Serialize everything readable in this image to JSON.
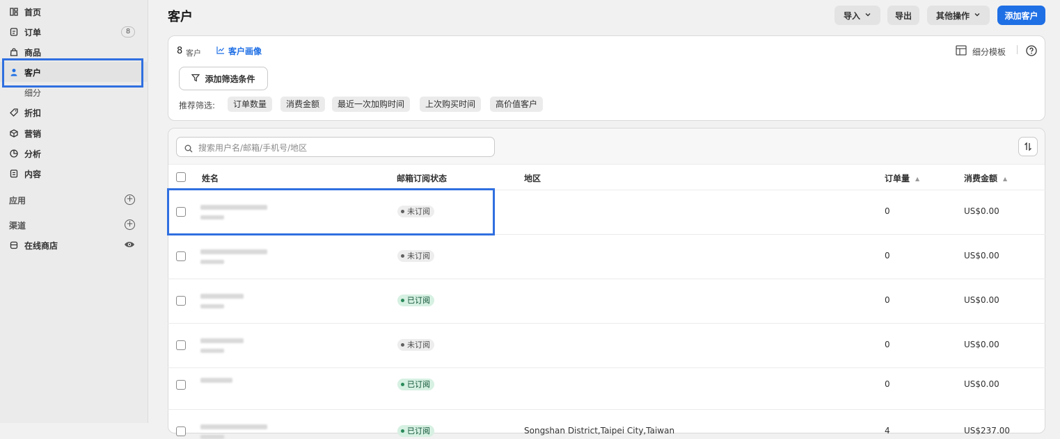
{
  "sidebar": {
    "items": [
      {
        "label": "首页",
        "icon": "home-icon"
      },
      {
        "label": "订单",
        "icon": "orders-icon",
        "badge": "8"
      },
      {
        "label": "商品",
        "icon": "tag-bag-icon"
      },
      {
        "label": "客户",
        "icon": "person-icon"
      },
      {
        "label": "细分"
      },
      {
        "label": "折扣",
        "icon": "discount-icon"
      },
      {
        "label": "营销",
        "icon": "target-icon"
      },
      {
        "label": "分析",
        "icon": "chart-pie-icon"
      },
      {
        "label": "内容",
        "icon": "document-icon"
      }
    ],
    "apps_label": "应用",
    "channels_label": "渠道",
    "store_label": "在线商店"
  },
  "header": {
    "title": "客户",
    "import_label": "导入",
    "export_label": "导出",
    "more_label": "其他操作",
    "add_label": "添加客户"
  },
  "filters": {
    "count": "8",
    "count_unit": "客户",
    "insights_label": "客户画像",
    "segment_template_label": "细分模板",
    "add_filter_label": "添加筛选条件",
    "recommended_label": "推荐筛选:",
    "chips": [
      "订单数量",
      "消费金额",
      "最近一次加购时间",
      "上次购买时间",
      "高价值客户"
    ]
  },
  "table": {
    "search_placeholder": "搜索用户名/邮箱/手机号/地区",
    "columns": {
      "name": "姓名",
      "email_status": "邮箱订阅状态",
      "region": "地区",
      "orders": "订单量",
      "spent": "消费金额"
    },
    "rows": [
      {
        "status": "未订阅",
        "subscribed": false,
        "region": "",
        "orders": "0",
        "spent": "US$0.00"
      },
      {
        "status": "未订阅",
        "subscribed": false,
        "region": "",
        "orders": "0",
        "spent": "US$0.00"
      },
      {
        "status": "已订阅",
        "subscribed": true,
        "region": "",
        "orders": "0",
        "spent": "US$0.00"
      },
      {
        "status": "未订阅",
        "subscribed": false,
        "region": "",
        "orders": "0",
        "spent": "US$0.00"
      },
      {
        "status": "已订阅",
        "subscribed": true,
        "region": "",
        "orders": "0",
        "spent": "US$0.00"
      },
      {
        "status": "已订阅",
        "subscribed": true,
        "region": "Songshan District,Taipei City,Taiwan",
        "orders": "4",
        "spent": "US$237.00"
      }
    ]
  },
  "colors": {
    "accent": "#1f6fe5",
    "highlight": "#2f6fe0",
    "subscribed_bg": "#d6f0e2"
  }
}
